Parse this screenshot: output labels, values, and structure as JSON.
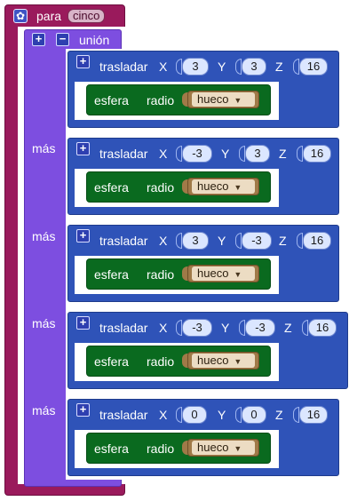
{
  "procedure": {
    "keyword": "para",
    "name": "cinco",
    "gear_icon": "gear-icon",
    "accent": "#9a1a5c"
  },
  "union": {
    "label": "unión",
    "plus_label": "+",
    "minus_label": "−",
    "else_label": "más",
    "accent": "#7d4ee0"
  },
  "translate_blocks": [
    {
      "label": "trasladar",
      "x_label": "X",
      "x": "3",
      "y_label": "Y",
      "y": "3",
      "z_label": "Z",
      "z": "16",
      "sphere": {
        "label": "esfera",
        "radius_label": "radio",
        "radius_var": "hueco"
      }
    },
    {
      "label": "trasladar",
      "x_label": "X",
      "x": "-3",
      "y_label": "Y",
      "y": "3",
      "z_label": "Z",
      "z": "16",
      "sphere": {
        "label": "esfera",
        "radius_label": "radio",
        "radius_var": "hueco"
      }
    },
    {
      "label": "trasladar",
      "x_label": "X",
      "x": "3",
      "y_label": "Y",
      "y": "-3",
      "z_label": "Z",
      "z": "16",
      "sphere": {
        "label": "esfera",
        "radius_label": "radio",
        "radius_var": "hueco"
      }
    },
    {
      "label": "trasladar",
      "x_label": "X",
      "x": "-3",
      "y_label": "Y",
      "y": "-3",
      "z_label": "Z",
      "z": "16",
      "sphere": {
        "label": "esfera",
        "radius_label": "radio",
        "radius_var": "hueco"
      }
    },
    {
      "label": "trasladar",
      "x_label": "X",
      "x": "0",
      "y_label": "Y",
      "y": "0",
      "z_label": "Z",
      "z": "16",
      "sphere": {
        "label": "esfera",
        "radius_label": "radio",
        "radius_var": "hueco"
      }
    }
  ],
  "colors": {
    "translate": "#2f53b8",
    "sphere": "#0a6a1f",
    "variable": "#a07a48"
  }
}
